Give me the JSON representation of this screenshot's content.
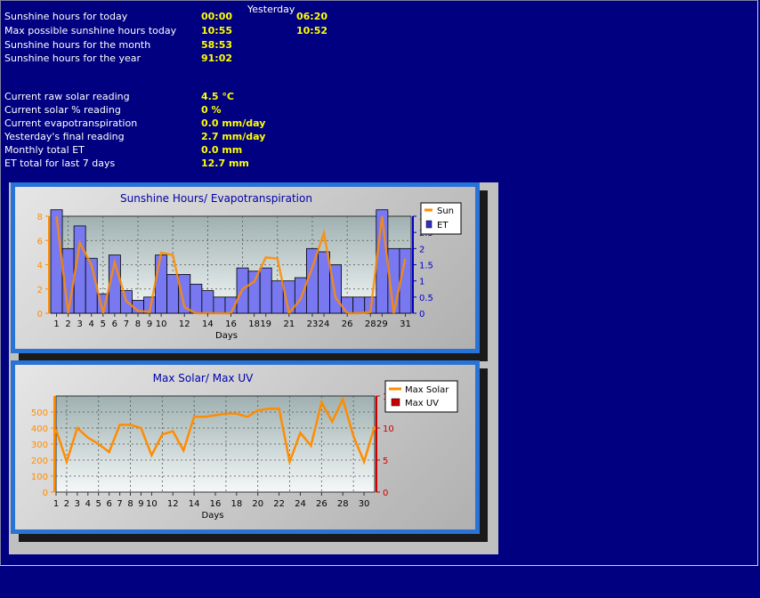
{
  "header": {
    "yesterday_label": "Yesterday"
  },
  "stats": [
    {
      "label": "Sunshine hours for today",
      "value": "00:00",
      "yesterday": "06:20"
    },
    {
      "label": "Max possible sunshine hours today",
      "value": "10:55",
      "yesterday": "10:52"
    },
    {
      "label": "Sunshine hours for the month",
      "value": "58:53",
      "yesterday": ""
    },
    {
      "label": "Sunshine hours for the year",
      "value": "91:02",
      "yesterday": ""
    }
  ],
  "solar": [
    {
      "label": "Current raw solar reading",
      "value": "4.5 °C"
    },
    {
      "label": "Current solar % reading",
      "value": "0 %"
    },
    {
      "label": "Current evapotranspiration",
      "value": "0.0 mm/day"
    },
    {
      "label": "Yesterday's final reading",
      "value": "2.7 mm/day"
    },
    {
      "label": "Monthly total ET",
      "value": "0.0 mm"
    },
    {
      "label": "ET total for last 7 days",
      "value": "12.7 mm"
    }
  ],
  "colors": {
    "background": "#000080",
    "label": "#ffffff",
    "value": "#ffff00",
    "panel": "#2a73d6",
    "sun_line": "#ff8c00",
    "et_bar": "#7878f0",
    "uv": "#cc0000",
    "title": "#0000aa"
  },
  "chart_data": [
    {
      "type": "bar",
      "title": "Sunshine Hours/ Evapotranspiration",
      "xlabel": "Days",
      "x_ticks": [
        "1",
        "2",
        "3",
        "4",
        "5",
        "6",
        "7",
        "8",
        "9",
        "10",
        "12",
        "14",
        "16",
        "18",
        "19",
        "21",
        "23",
        "24",
        "26",
        "28",
        "29",
        "31"
      ],
      "days": [
        1,
        2,
        3,
        4,
        5,
        6,
        7,
        8,
        9,
        10,
        11,
        12,
        13,
        14,
        15,
        16,
        17,
        18,
        19,
        20,
        21,
        22,
        23,
        24,
        25,
        26,
        27,
        28,
        29,
        30,
        31
      ],
      "ylim_left": [
        0,
        8
      ],
      "yticks_left": [
        0,
        2,
        4,
        6,
        8
      ],
      "ylim_right": [
        0,
        3
      ],
      "yticks_right": [
        "0",
        "0.5",
        "1",
        "1.5",
        "2",
        "2.5",
        "3"
      ],
      "legend": [
        "Sun",
        "ET"
      ],
      "legend_position": "top-right",
      "series": [
        {
          "name": "ET",
          "axis": "right",
          "values": [
            3.2,
            2.0,
            2.7,
            1.7,
            0.6,
            1.8,
            0.7,
            0.4,
            0.5,
            1.8,
            1.2,
            1.2,
            0.9,
            0.7,
            0.5,
            0.5,
            1.4,
            1.3,
            1.4,
            1.0,
            1.0,
            1.1,
            2.0,
            1.9,
            1.5,
            0.5,
            0.5,
            0.5,
            3.2,
            2.0,
            2.0
          ]
        },
        {
          "name": "Sun",
          "axis": "left",
          "values": [
            8.0,
            0.0,
            5.8,
            4.0,
            0.0,
            4.2,
            1.0,
            0.2,
            0.1,
            5.0,
            4.8,
            0.5,
            0.0,
            0.0,
            0.0,
            0.0,
            2.0,
            2.6,
            4.6,
            4.5,
            0.0,
            1.2,
            3.8,
            6.6,
            1.3,
            0.0,
            0.0,
            0.1,
            8.0,
            0.0,
            4.5
          ]
        }
      ]
    },
    {
      "type": "line",
      "title": "Max Solar/ Max UV",
      "xlabel": "Days",
      "x_ticks": [
        "1",
        "2",
        "3",
        "4",
        "5",
        "6",
        "7",
        "8",
        "9",
        "10",
        "12",
        "14",
        "16",
        "18",
        "20",
        "22",
        "24",
        "26",
        "28",
        "30"
      ],
      "days": [
        1,
        2,
        3,
        4,
        5,
        6,
        7,
        8,
        9,
        10,
        11,
        12,
        13,
        14,
        15,
        16,
        17,
        18,
        19,
        20,
        21,
        22,
        23,
        24,
        25,
        26,
        27,
        28,
        29,
        30,
        31
      ],
      "ylim_left": [
        0,
        600
      ],
      "yticks_left": [
        0,
        100,
        200,
        300,
        400,
        500
      ],
      "ylim_right": [
        0,
        15
      ],
      "yticks_right": [
        0,
        5,
        10,
        15
      ],
      "legend": [
        "Max Solar",
        "Max UV"
      ],
      "legend_position": "top-right",
      "series": [
        {
          "name": "Max Solar",
          "axis": "left",
          "values": [
            390,
            190,
            400,
            340,
            300,
            250,
            420,
            420,
            400,
            230,
            360,
            380,
            260,
            470,
            470,
            480,
            490,
            490,
            470,
            510,
            520,
            520,
            190,
            370,
            290,
            560,
            440,
            580,
            350,
            190,
            410
          ]
        },
        {
          "name": "Max UV",
          "axis": "right",
          "values": []
        }
      ]
    }
  ]
}
